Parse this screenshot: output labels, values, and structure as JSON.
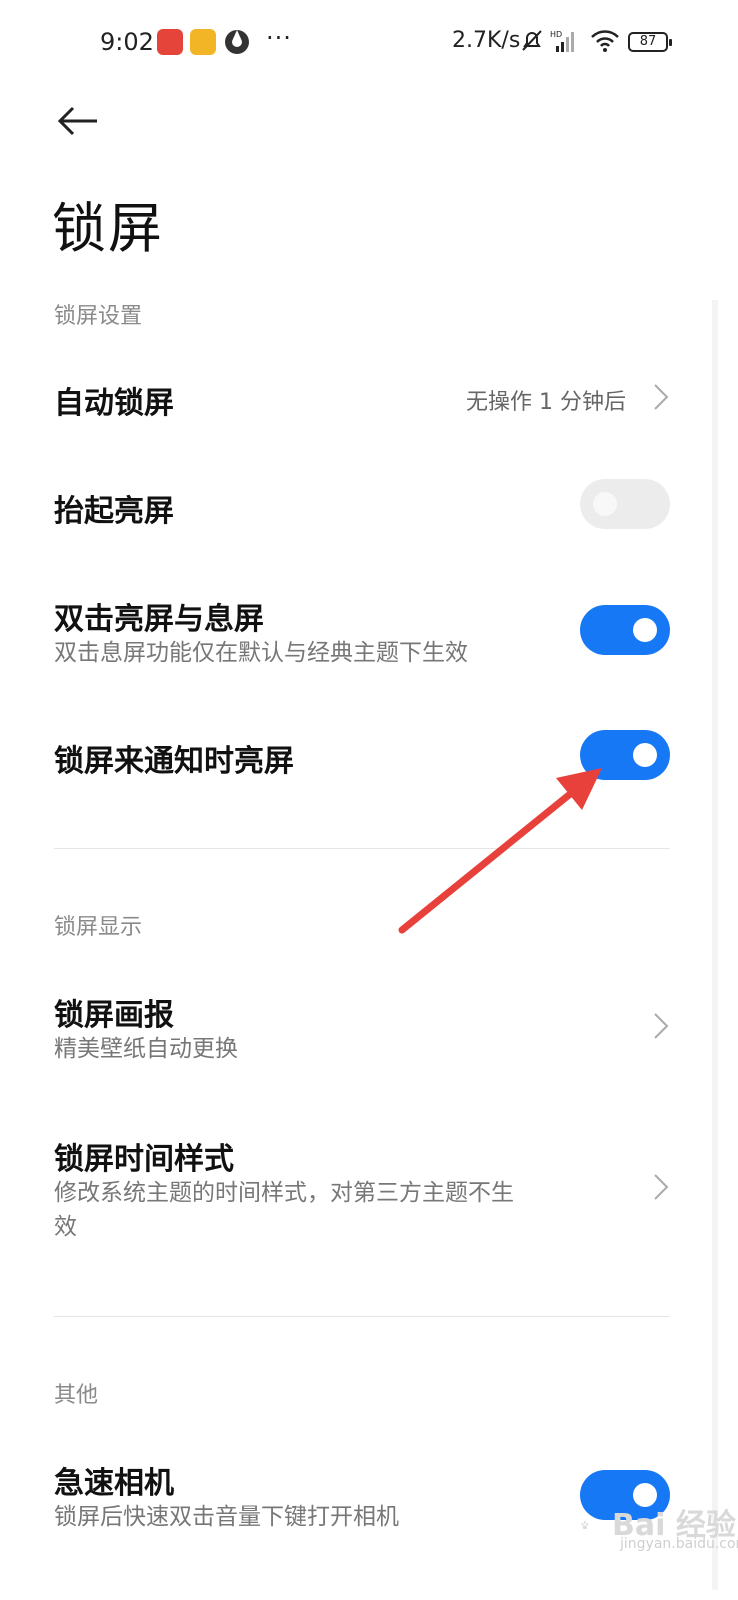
{
  "status_bar": {
    "time": "9:02",
    "dots": "···",
    "net_speed": "2.7K/s",
    "battery": "87"
  },
  "page": {
    "title": "锁屏"
  },
  "sections": [
    {
      "header": "锁屏设置",
      "items": [
        {
          "title": "自动锁屏",
          "value": "无操作 1 分钟后"
        },
        {
          "title": "抬起亮屏",
          "toggle": "off"
        },
        {
          "title": "双击亮屏与息屏",
          "subtitle": "双击息屏功能仅在默认与经典主题下生效",
          "toggle": "on"
        },
        {
          "title": "锁屏来通知时亮屏",
          "toggle": "on"
        }
      ]
    },
    {
      "header": "锁屏显示",
      "items": [
        {
          "title": "锁屏画报",
          "subtitle": "精美壁纸自动更换"
        },
        {
          "title": "锁屏时间样式",
          "subtitle_line1": "修改系统主题的时间样式，对第三方主题不生",
          "subtitle_line2": "效"
        }
      ]
    },
    {
      "header": "其他",
      "items": [
        {
          "title": "急速相机",
          "subtitle": "锁屏后快速双击音量下键打开相机",
          "toggle": "on"
        }
      ]
    }
  ],
  "watermark": {
    "text": "Bai 经验",
    "sub": "jingyan.baidu.com"
  },
  "colors": {
    "accent": "#1778f5",
    "annotation_arrow": "#e8403a"
  }
}
